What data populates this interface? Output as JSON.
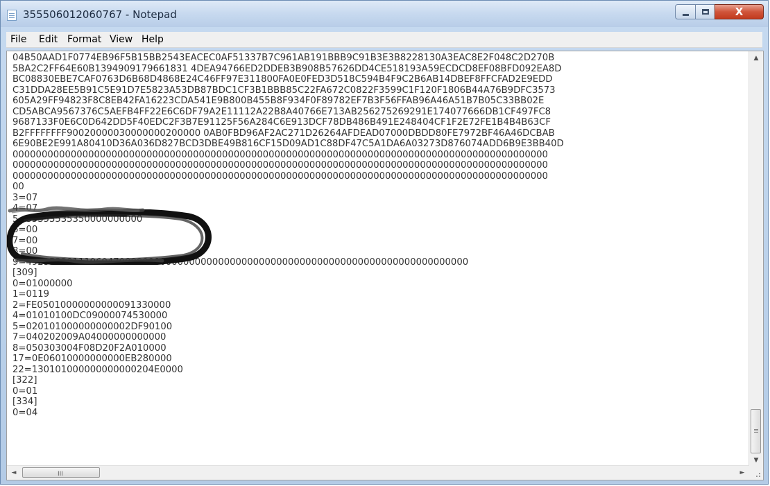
{
  "window": {
    "title": "355506012060767 - Notepad",
    "controls": {
      "minimize": "",
      "maximize": "",
      "close": "X"
    }
  },
  "menu": [
    "File",
    "Edit",
    "Format",
    "View",
    "Help"
  ],
  "document": {
    "lines": [
      "04B50AAD1F0774EB96F5B15BB2543EACEC0AF51337B7C961AB191BBB9C91B3E3B8228130A3EAC8E2F048C2D270B",
      "5BA2C2FF64E60B1394909179661831 4DEA94766ED2DDEB3B908B57626DD4CE518193A59ECDCD8EF08BFD092EA8D",
      "BC08830EBE7CAF0763D6B68D4868E24C46FF97E311800FA0E0FED3D518C594B4F9C2B6AB14DBEF8FFCFAD2E9EDD",
      "C31DDA28EE5B91C5E91D7E5823A53DB87BDC1CF3B1BBB85C22FA672C0822F3599C1F120F1806B44A76B9DFC3573",
      "605A29FF94823F8C8EB42FA16223CDA541E9B800B455B8F934F0F89782EF7B3F56FFAB96A46A51B7B05C33BB02E",
      "CD5ABCA9567376C5AEFB4FF22E6C6DF79A2E11112A22B8A40766E713AB256275269291E174077666DB1CF497FC8",
      "9687133F0E6C0D642DD5F40EDC2F3B7E91125F56A284C6E913DCF78DB486B491E248404CF1F2E72FE1B4B4B63CF",
      "B2FFFFFFFF90020000030000000200000 0AB0FBD96AF2AC271D26264AFDEAD07000DBDD80FE7972BF46A46DCBAB",
      "6E90BE2E991A80410D36A036D827BCD3DBE49B816CF15D09AD1C88DF47C5A1DA6A03273D876074ADD6B9E3BB40D",
      "00000000000000000000000000000000000000000000000000000000000000000000000000000000000000000000",
      "00000000000000000000000000000000000000000000000000000000000000000000000000000000000000000000",
      "00000000000000000000000000000000000000000000000000000000000000000000000000000000000000000000",
      "00",
      "3=07",
      "4=07",
      "5=35353535350000000000",
      "6=00",
      "7=00",
      "8=00",
      "9=4923532011196047000000000000000000000000000000000000000000000000000000000000",
      "[309]",
      "0=01000000",
      "1=0119",
      "2=FE05010000000000091330000",
      "4=01010100DC09000074530000",
      "5=020101000000000002DF90100",
      "7=040202009A04000000000000",
      "8=050303004F08D20F2A010000",
      "17=0E06010000000000EB280000",
      "22=130101000000000000204E0000",
      "[322]",
      "0=01",
      "[334]",
      "0=04"
    ]
  },
  "scrollbars": {
    "up_arrow": "▲",
    "down_arrow": "▼",
    "left_arrow": "◄",
    "right_arrow": "►",
    "h_grip": "III"
  }
}
